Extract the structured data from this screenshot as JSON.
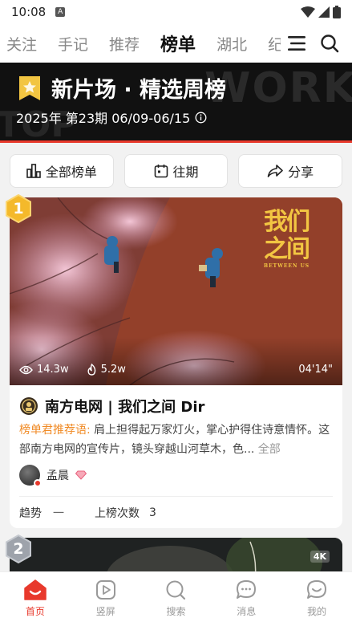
{
  "status": {
    "time": "10:08",
    "app_badge": "A"
  },
  "nav": {
    "tabs": [
      "关注",
      "手记",
      "推荐",
      "榜单",
      "湖北",
      "纪"
    ],
    "active_tab": "榜单"
  },
  "banner": {
    "title": "新片场 · 精选周榜",
    "subtitle": "2025年 第23期 06/09-06/15",
    "bg_text": "WORK",
    "bg_text2": "TOP"
  },
  "actions": {
    "all_ranks": "全部榜单",
    "past": "往期",
    "share": "分享"
  },
  "card1": {
    "rank": "1",
    "views": "14.3w",
    "hot": "5.2w",
    "duration": "04'14\"",
    "cover_title": "我们之间",
    "cover_subtitle": "BETWEEN US",
    "title": "南方电网 | 我们之间 Dir",
    "desc_label": "榜单君推荐语:",
    "desc_text": " 肩上担得起万家灯火，掌心护得住诗意情怀。这部南方电网的宣传片，镜头穿越山河草木，色...",
    "desc_more": " 全部",
    "author": "孟晨",
    "trend_label": "趋势",
    "trend_value": "一",
    "count_label": "上榜次数",
    "count_value": "3"
  },
  "card2": {
    "rank": "2",
    "tag": "4K"
  },
  "bottom_nav": [
    {
      "label": "首页",
      "icon": "home-icon"
    },
    {
      "label": "竖屏",
      "icon": "vertical-video-icon"
    },
    {
      "label": "搜索",
      "icon": "search-icon"
    },
    {
      "label": "消息",
      "icon": "message-icon"
    },
    {
      "label": "我的",
      "icon": "profile-icon"
    }
  ],
  "colors": {
    "accent": "#e8392c",
    "gold": "#f2c542",
    "desc_label": "#f08a24"
  }
}
